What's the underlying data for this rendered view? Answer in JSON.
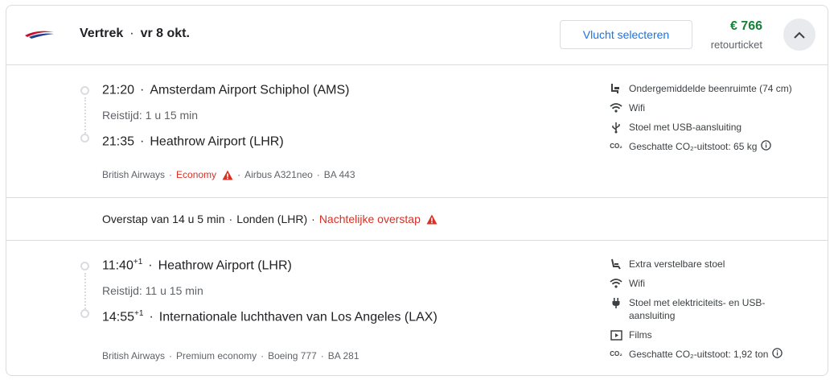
{
  "header": {
    "airline_logo_icon": "british-airways-logo",
    "direction": "Vertrek",
    "date": "vr 8 okt.",
    "select_label": "Vlucht selecteren",
    "price": "€ 766",
    "price_note": "retourticket",
    "collapse_icon": "chevron-up-icon"
  },
  "segments": [
    {
      "departure_time": "21:20",
      "departure_suffix": "",
      "departure_airport": "Amsterdam Airport Schiphol (AMS)",
      "duration": "Reistijd: 1 u 15 min",
      "arrival_time": "21:35",
      "arrival_suffix": "",
      "arrival_airport": "Heathrow Airport (LHR)",
      "airline": "British Airways",
      "cabin": "Economy",
      "aircraft": "Airbus A321neo",
      "flight_no": "BA 443",
      "amenities": [
        {
          "icon": "legroom-icon",
          "label": "Ondergemiddelde beenruimte (74 cm)"
        },
        {
          "icon": "wifi-icon",
          "label": "Wifi"
        },
        {
          "icon": "usb-icon",
          "label": "Stoel met USB-aansluiting"
        },
        {
          "icon": "co2-icon",
          "label": "Geschatte CO₂-uitstoot: 65 kg"
        }
      ]
    },
    {
      "departure_time": "11:40",
      "departure_suffix": "+1",
      "departure_airport": "Heathrow Airport (LHR)",
      "duration": "Reistijd: 11 u 15 min",
      "arrival_time": "14:55",
      "arrival_suffix": "+1",
      "arrival_airport": "Internationale luchthaven van Los Angeles (LAX)",
      "airline": "British Airways",
      "cabin": "Premium economy",
      "aircraft": "Boeing 777",
      "flight_no": "BA 281",
      "amenities": [
        {
          "icon": "recline-seat-icon",
          "label": "Extra verstelbare stoel"
        },
        {
          "icon": "wifi-icon",
          "label": "Wifi"
        },
        {
          "icon": "power-plug-icon",
          "label": "Stoel met elektriciteits- en USB-aansluiting"
        },
        {
          "icon": "film-icon",
          "label": "Films"
        },
        {
          "icon": "co2-icon",
          "label": "Geschatte CO₂-uitstoot: 1,92 ton"
        }
      ]
    }
  ],
  "layover": {
    "duration": "Overstap van 14 u 5 min",
    "city": "Londen (LHR)",
    "warning": "Nachtelijke overstap"
  },
  "colors": {
    "price_green": "#188038",
    "link_blue": "#1a73e8",
    "warning_red": "#d93025"
  }
}
